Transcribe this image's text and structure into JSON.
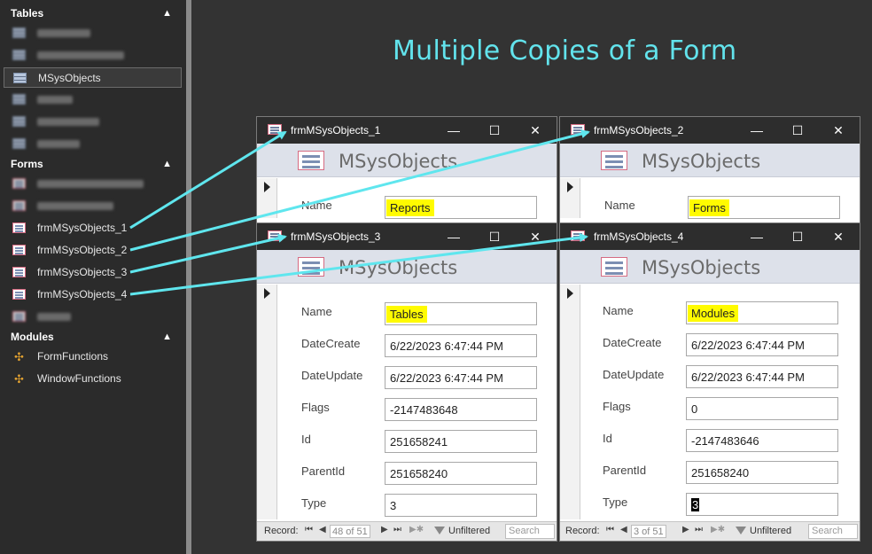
{
  "navigation_pane": {
    "tables": {
      "header": "Tables",
      "items": [
        {
          "label": "",
          "blurred": true
        },
        {
          "label": "",
          "blurred": true
        },
        {
          "label": "MSysObjects",
          "blurred": false
        },
        {
          "label": "",
          "blurred": true
        },
        {
          "label": "",
          "blurred": true
        },
        {
          "label": "",
          "blurred": true
        }
      ]
    },
    "forms": {
      "header": "Forms",
      "items": [
        {
          "label": "",
          "blurred": true
        },
        {
          "label": "",
          "blurred": true
        },
        {
          "label": "frmMSysObjects_1",
          "blurred": false
        },
        {
          "label": "frmMSysObjects_2",
          "blurred": false
        },
        {
          "label": "frmMSysObjects_3",
          "blurred": false
        },
        {
          "label": "frmMSysObjects_4",
          "blurred": false
        },
        {
          "label": "",
          "blurred": true
        }
      ]
    },
    "modules": {
      "header": "Modules",
      "items": [
        {
          "label": "FormFunctions"
        },
        {
          "label": "WindowFunctions"
        }
      ]
    }
  },
  "page_title": "Multiple Copies of a Form",
  "windows": [
    {
      "title": "frmMSysObjects_1",
      "header": "MSysObjects",
      "fields": [
        {
          "label": "Name",
          "value": "Reports",
          "highlight": true
        }
      ]
    },
    {
      "title": "frmMSysObjects_2",
      "header": "MSysObjects",
      "fields": [
        {
          "label": "Name",
          "value": "Forms",
          "highlight": true
        }
      ]
    },
    {
      "title": "frmMSysObjects_3",
      "header": "MSysObjects",
      "fields": [
        {
          "label": "Name",
          "value": "Tables",
          "highlight": true
        },
        {
          "label": "DateCreate",
          "value": "6/22/2023 6:47:44 PM"
        },
        {
          "label": "DateUpdate",
          "value": "6/22/2023 6:47:44 PM"
        },
        {
          "label": "Flags",
          "value": "-2147483648"
        },
        {
          "label": "Id",
          "value": "251658241"
        },
        {
          "label": "ParentId",
          "value": "251658240"
        },
        {
          "label": "Type",
          "value": "3"
        }
      ],
      "record_nav": {
        "label": "Record:",
        "position": "48 of 51",
        "filter": "Unfiltered",
        "search": "Search"
      }
    },
    {
      "title": "frmMSysObjects_4",
      "header": "MSysObjects",
      "fields": [
        {
          "label": "Name",
          "value": "Modules",
          "highlight": true
        },
        {
          "label": "DateCreate",
          "value": "6/22/2023 6:47:44 PM"
        },
        {
          "label": "DateUpdate",
          "value": "6/22/2023 6:47:44 PM"
        },
        {
          "label": "Flags",
          "value": "0"
        },
        {
          "label": "Id",
          "value": "-2147483646"
        },
        {
          "label": "ParentId",
          "value": "251658240"
        },
        {
          "label": "Type",
          "value": "3"
        }
      ],
      "record_nav": {
        "label": "Record:",
        "position": "3 of 51",
        "filter": "Unfiltered",
        "search": "Search"
      }
    }
  ],
  "window_buttons": {
    "minimize": "—",
    "maximize": "☐",
    "close": "✕"
  },
  "colors": {
    "arrow": "#5fe6ee",
    "highlight": "#fffb00",
    "title": "#62e3ec"
  }
}
